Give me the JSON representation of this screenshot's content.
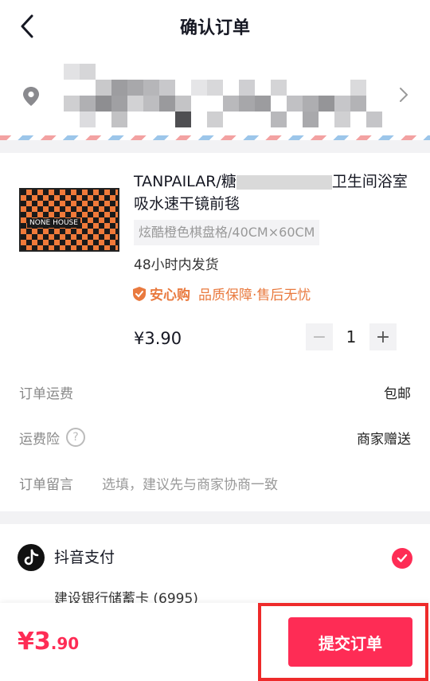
{
  "header": {
    "title": "确认订单"
  },
  "product": {
    "title_part1": "TANPAILAR/糖",
    "title_part2": "卫生间浴室",
    "title_part3": "吸水速干镜前毯",
    "sku": "炫酷橙色棋盘格/40CM×60CM",
    "shipping": "48小时内发货",
    "badge_name": "安心购",
    "badge_text": "品质保障·售后无忧",
    "thumb_logo": "NONE HOUSE",
    "price": "¥3.90",
    "quantity": "1",
    "minus": "−",
    "plus": "+"
  },
  "rows": {
    "freight_label": "订单运费",
    "freight_value": "包邮",
    "insurance_label": "运费险",
    "insurance_help": "?",
    "insurance_value": "商家赠送",
    "note_label": "订单留言",
    "note_placeholder": "选填，建议先与商家协商一致"
  },
  "payment": {
    "method": "抖音支付",
    "bank": "建设银行储蓄卡 (6995)"
  },
  "footer": {
    "total_main": "¥3",
    "total_decimal": ".90",
    "submit_label": "提交订单"
  },
  "colors": {
    "accent": "#fe2c55",
    "badge": "#e97a3f",
    "highlight": "#ee2a2a"
  }
}
